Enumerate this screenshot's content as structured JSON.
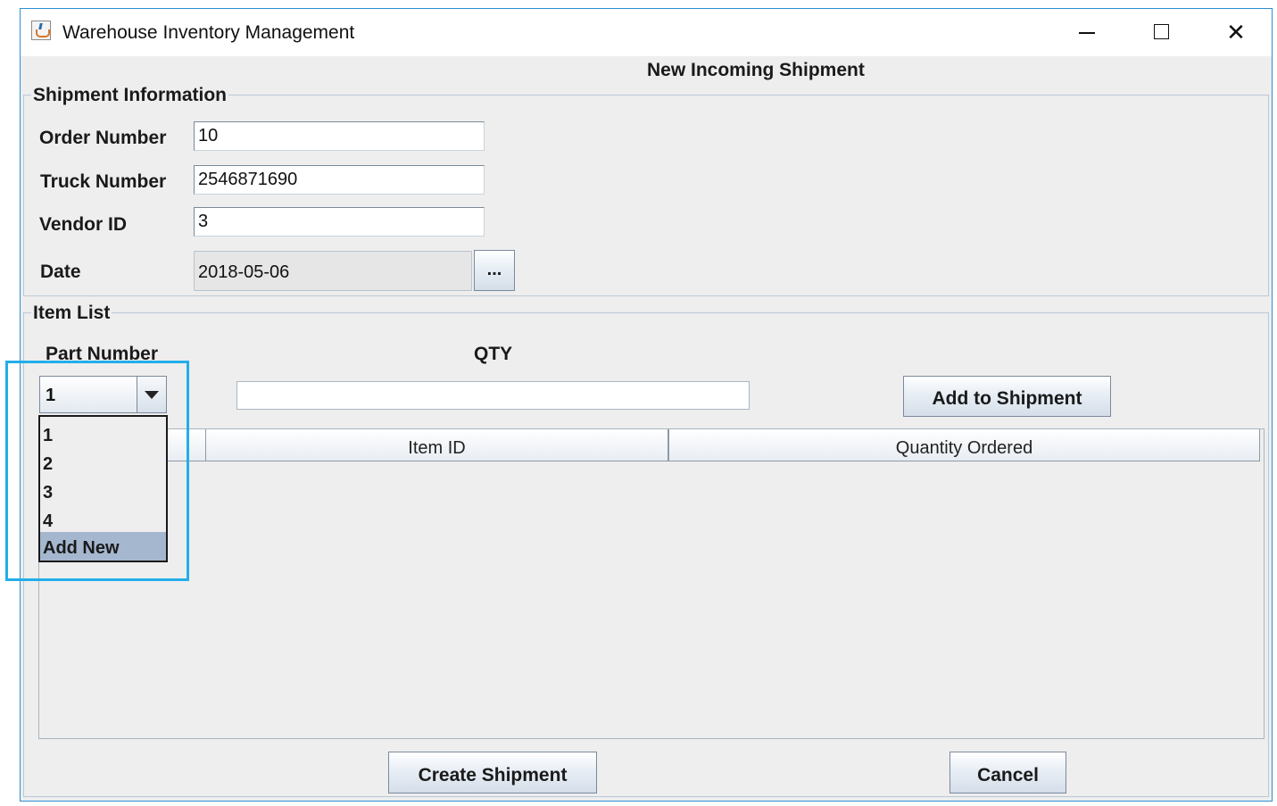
{
  "window": {
    "title": "Warehouse Inventory Management",
    "controls": {
      "minimize": "minimize-icon",
      "maximize": "maximize-icon",
      "close": "✕"
    }
  },
  "form": {
    "heading": "New Incoming Shipment",
    "shipment_info": {
      "legend": "Shipment Information",
      "order_number": {
        "label": "Order Number",
        "value": "10"
      },
      "truck_number": {
        "label": "Truck Number",
        "value": "2546871690"
      },
      "vendor_id": {
        "label": "Vendor ID",
        "value": "3"
      },
      "date": {
        "label": "Date",
        "value": "2018-05-06",
        "picker_label": "..."
      }
    },
    "item_list": {
      "legend": "Item List",
      "part_number_label": "Part Number",
      "qty_label": "QTY",
      "part_number_selected": "1",
      "part_number_options": [
        "1",
        "2",
        "3",
        "4",
        "Add New"
      ],
      "highlighted_option": "Add New",
      "qty_value": "",
      "add_button": "Add to Shipment",
      "table_columns": [
        "",
        "Item ID",
        "Quantity Ordered"
      ]
    },
    "create_button": "Create Shipment",
    "cancel_button": "Cancel"
  },
  "colors": {
    "window_border": "#2f8ecf",
    "panel_bg": "#eeeeee",
    "selection": "#a5b7cf",
    "annotation_highlight": "#22aee8"
  }
}
